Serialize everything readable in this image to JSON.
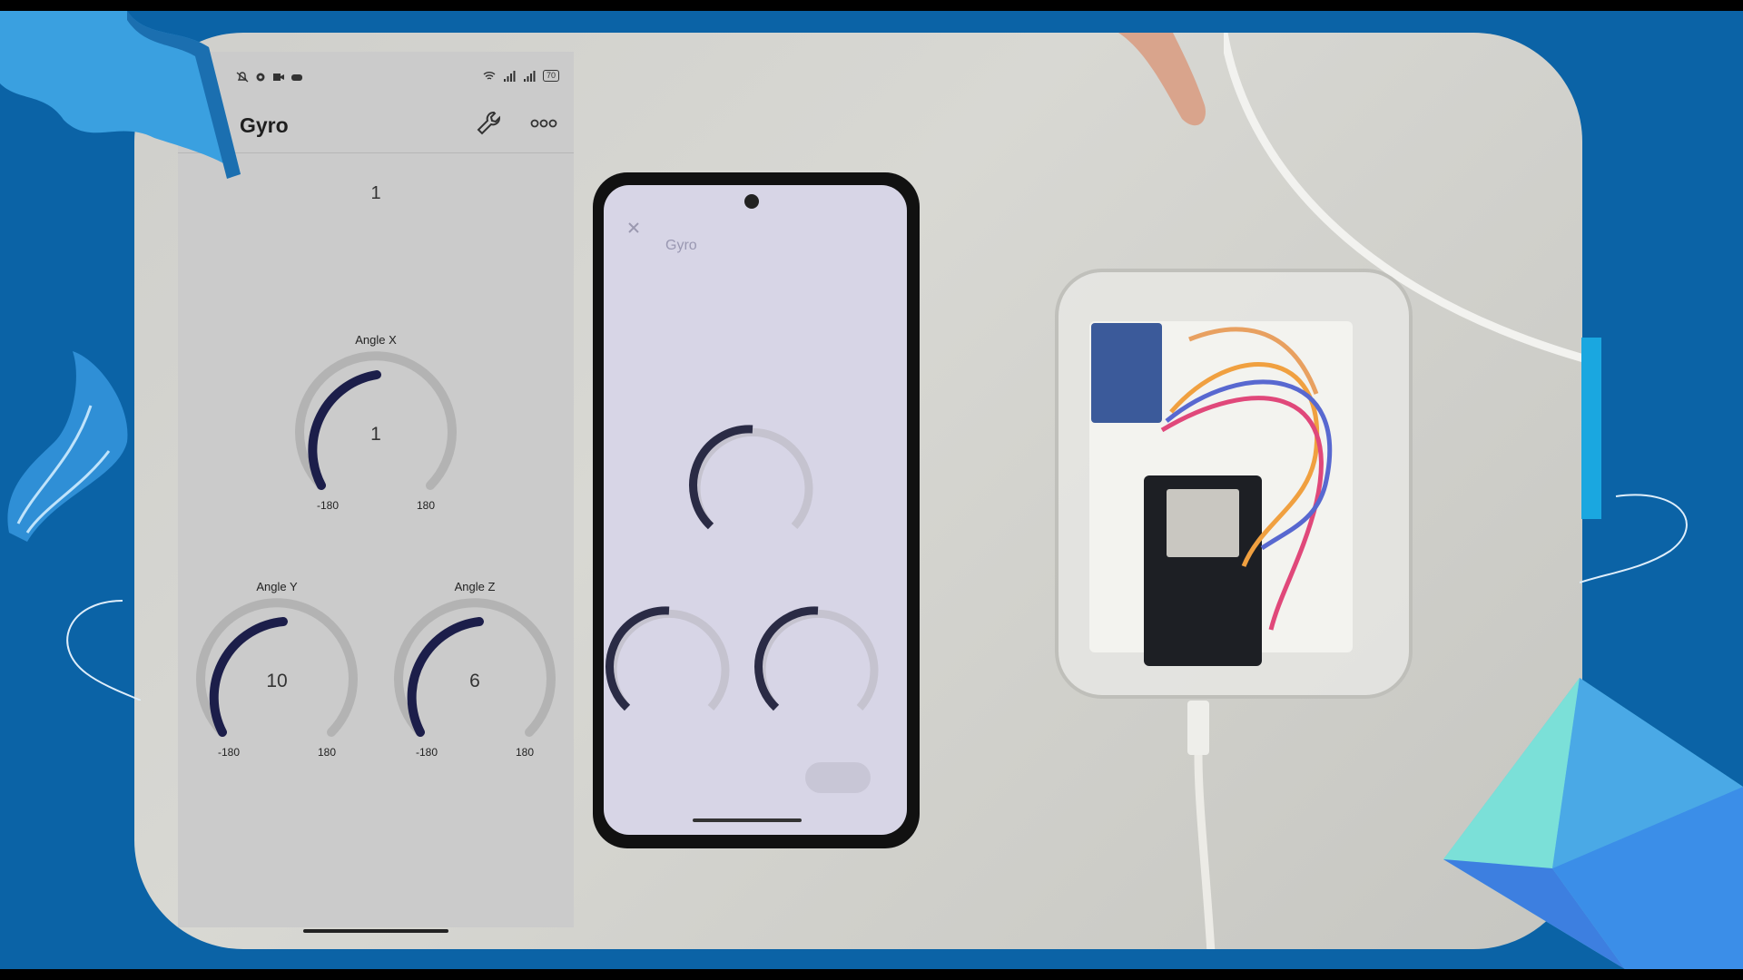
{
  "app": {
    "title": "Gyro",
    "battery": "70",
    "top_value": "1",
    "gauges": [
      {
        "name": "Angle X",
        "value": "1",
        "min": "-180",
        "max": "180"
      },
      {
        "name": "Angle Y",
        "value": "10",
        "min": "-180",
        "max": "180"
      },
      {
        "name": "Angle Z",
        "value": "6",
        "min": "-180",
        "max": "180"
      }
    ]
  },
  "photo_phone": {
    "title": "Gyro"
  },
  "colors": {
    "background": "#0b63a6",
    "gauge_fill": "#1c1e4a",
    "gauge_track": "#b3b3b3",
    "app_bg": "#cbcbcb"
  },
  "icons": [
    "bell-off-icon",
    "gear-icon",
    "video-icon",
    "game-icon",
    "wifi-icon",
    "signal-icon",
    "battery-icon",
    "wrench-icon",
    "more-icon",
    "close-icon"
  ]
}
